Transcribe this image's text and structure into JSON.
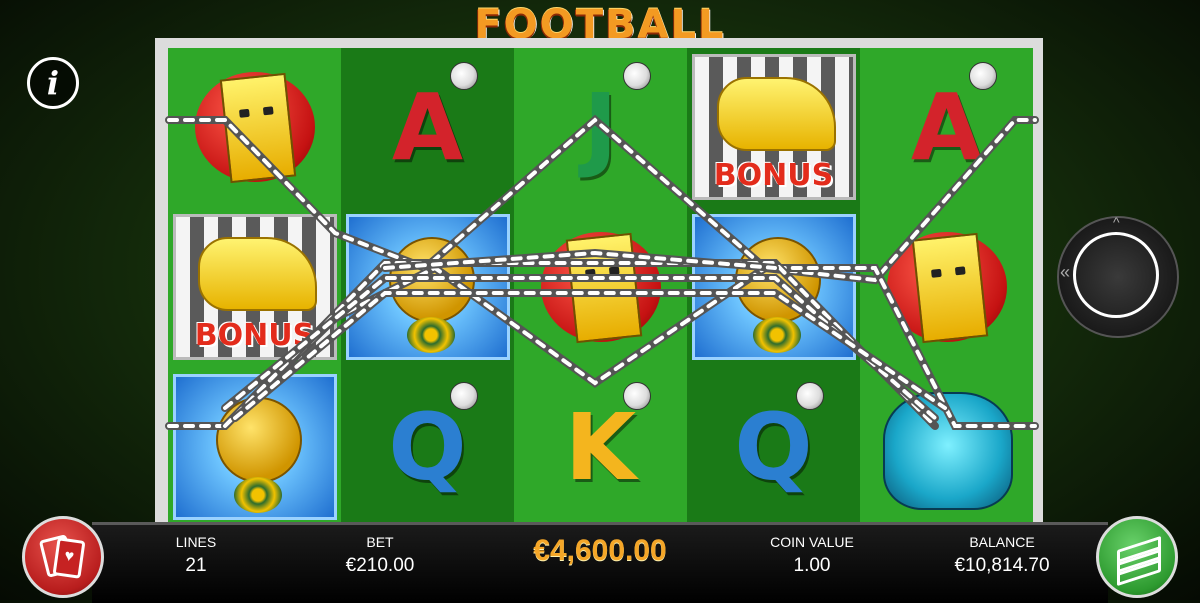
{
  "game": {
    "title": "FOOTBALL"
  },
  "info_button": {
    "glyph": "i"
  },
  "reels": [
    {
      "symbols": [
        "yellow-card",
        "bonus-whistle",
        "trophy"
      ]
    },
    {
      "symbols": [
        "A",
        "trophy",
        "Q"
      ]
    },
    {
      "symbols": [
        "J",
        "yellow-card",
        "K"
      ]
    },
    {
      "symbols": [
        "bonus-whistle",
        "trophy",
        "Q"
      ]
    },
    {
      "symbols": [
        "A",
        "yellow-card",
        "goalkeeper-glove"
      ]
    }
  ],
  "symbol_labels": {
    "A": "A",
    "J": "J",
    "K": "K",
    "Q": "Q",
    "bonus": "BONUS"
  },
  "symbol_colors": {
    "A": "#d3232b",
    "J": "#1f9a4a",
    "K": "#f4b51e",
    "Q": "#2b7fd1"
  },
  "hud": {
    "lines_label": "LINES",
    "lines_value": "21",
    "bet_label": "BET",
    "bet_value": "€210.00",
    "win_value": "€4,600.00",
    "coin_value_label": "COIN VALUE",
    "coin_value": "1.00",
    "balance_label": "BALANCE",
    "balance_value": "€10,814.70"
  },
  "colors": {
    "win": "#f4a628",
    "title": "#f39a22",
    "pitch_dark": "#1a7a17",
    "pitch_light": "#2fa829"
  }
}
